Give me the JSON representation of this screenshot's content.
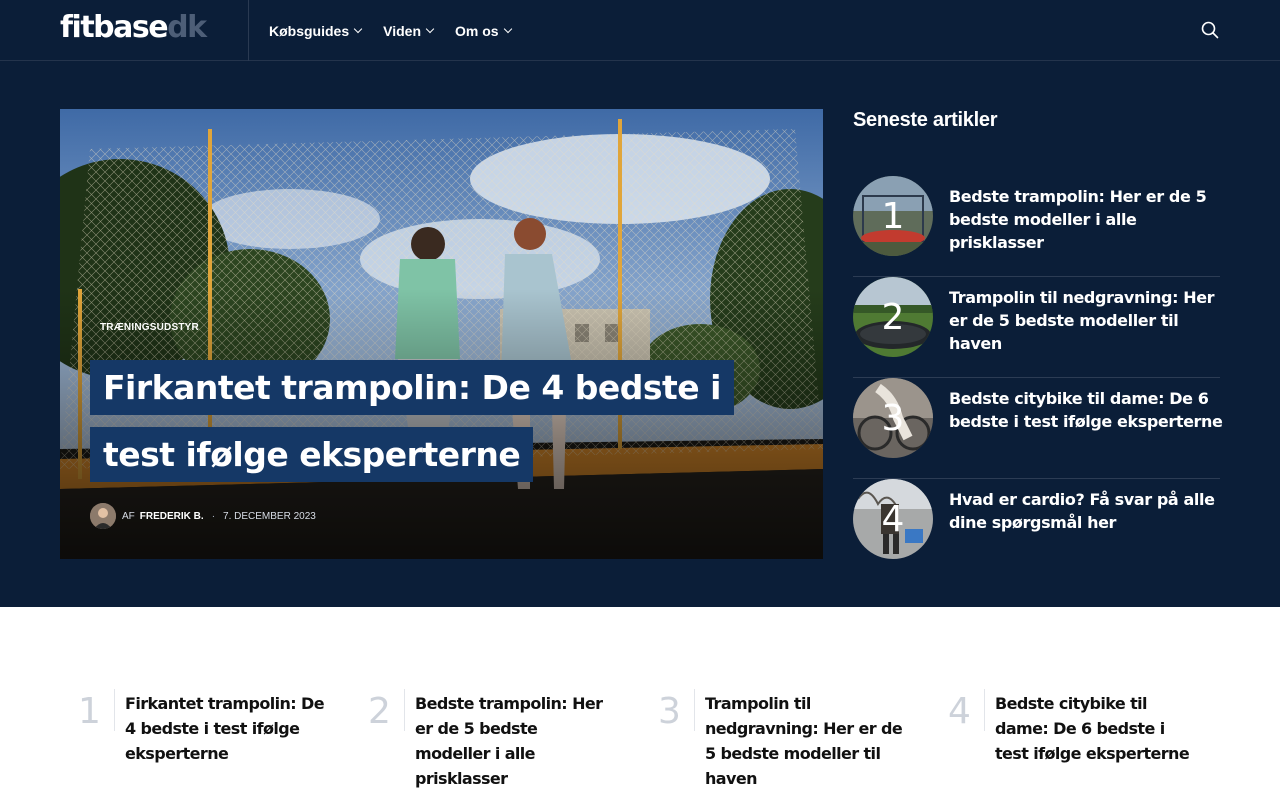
{
  "header": {
    "logo_main": "fitbase",
    "logo_tld": "dk",
    "nav": [
      {
        "label": "Købsguides"
      },
      {
        "label": "Viden"
      },
      {
        "label": "Om os"
      }
    ],
    "search_icon": "search-icon"
  },
  "feature": {
    "category": "TRÆNINGSUDSTYR",
    "title": "Firkantet trampolin: De 4 bedste i test ifølge eksperterne",
    "by": "AF",
    "author": "FREDERIK B.",
    "date": "7. DECEMBER 2023"
  },
  "sidebar": {
    "title": "Seneste artikler",
    "items": [
      {
        "num": "1",
        "title": "Bedste trampolin: Her er de 5 bedste modeller i alle prisklasser"
      },
      {
        "num": "2",
        "title": "Trampolin til nedgravning: Her er de 5 bedste modeller til haven"
      },
      {
        "num": "3",
        "title": "Bedste citybike til dame: De 6 bedste i test ifølge eksperterne"
      },
      {
        "num": "4",
        "title": "Hvad er cardio? Få svar på alle dine spørgsmål her"
      }
    ]
  },
  "popular": [
    {
      "num": "1",
      "title": "Firkantet trampolin: De 4 bedste i test ifølge eksperterne"
    },
    {
      "num": "2",
      "title": "Bedste trampolin: Her er de 5 bedste modeller i alle prisklasser"
    },
    {
      "num": "3",
      "title": "Trampolin til nedgravning: Her er de 5 bedste modeller til haven"
    },
    {
      "num": "4",
      "title": "Bedste citybike til dame: De 6 bedste i test ifølge eksperterne"
    }
  ],
  "colors": {
    "navy": "#0b1e38",
    "headline_bg": "#153866",
    "logo_tld": "#4d5e77"
  }
}
